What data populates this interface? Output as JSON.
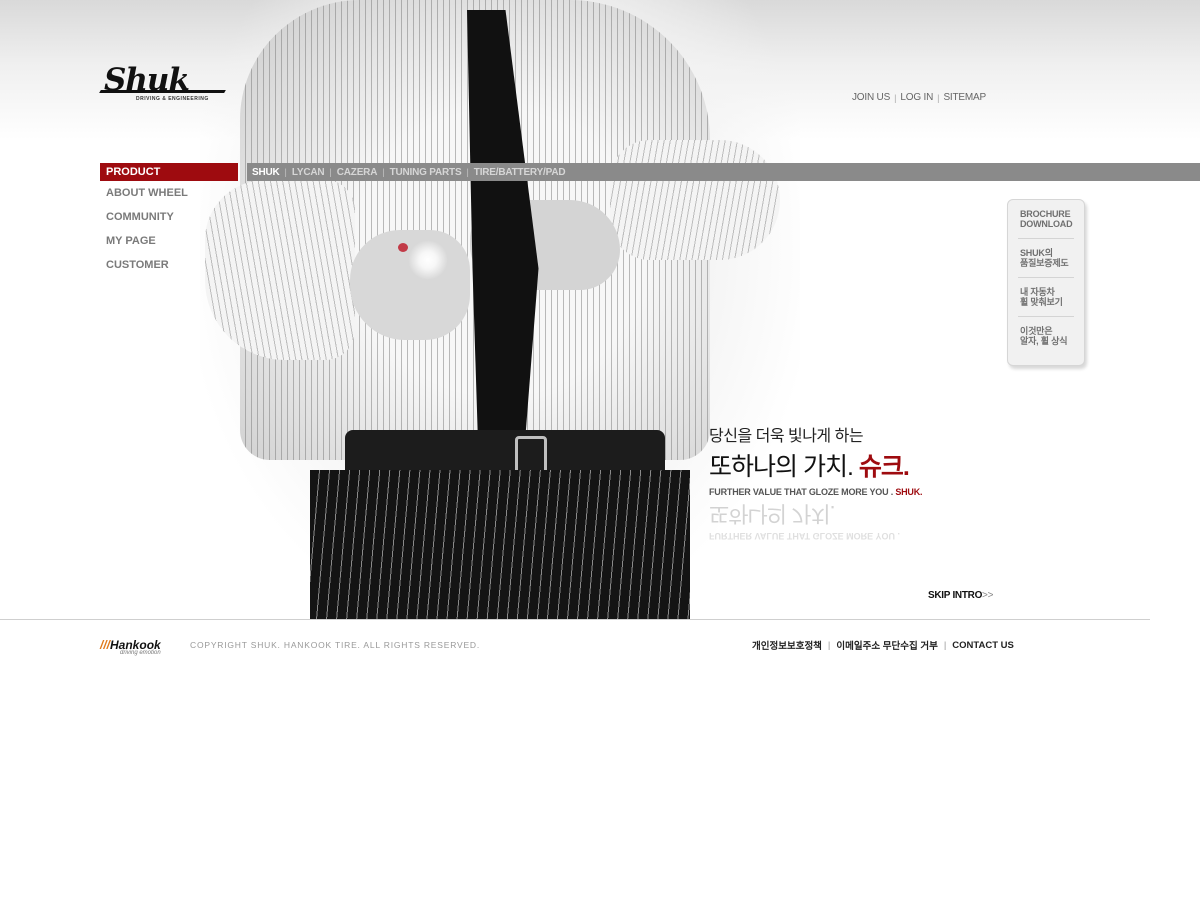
{
  "header": {
    "logo_text": "Shuk",
    "logo_sub": "DRIVING & ENGINEERING",
    "util_nav": [
      "JOIN US",
      "LOG IN",
      "SITEMAP"
    ]
  },
  "left_nav": {
    "active": "PRODUCT",
    "items": [
      "ABOUT WHEEL",
      "COMMUNITY",
      "MY PAGE",
      "CUSTOMER"
    ]
  },
  "product_bar": {
    "items": [
      "SHUK",
      "LYCAN",
      "CAZERA",
      "TUNING PARTS",
      "TIRE/BATTERY/PAD"
    ]
  },
  "side_menu": {
    "items": [
      {
        "line1": "BROCHURE",
        "line2": "DOWNLOAD"
      },
      {
        "line1": "SHUK의",
        "line2": "품질보증제도"
      },
      {
        "line1": "내 자동차",
        "line2": "휠 맞춰보기"
      },
      {
        "line1": "이것만은",
        "line2": "알자, 휠 상식"
      }
    ]
  },
  "tagline": {
    "line1": "당신을 더욱 빛나게 하는",
    "line2": "또하나의 가치.",
    "brand_kr": "슈크.",
    "english": "FURTHER VALUE THAT GLOZE MORE YOU .",
    "brand_en": "SHUK."
  },
  "skip_intro": {
    "label": "SKIP INTRO",
    "arrows": ">>"
  },
  "footer": {
    "logo": "Hankook",
    "logo_sub": "driving emotion",
    "copyright": "COPYRIGHT SHUK. HANKOOK TIRE. ALL RIGHTS RESERVED.",
    "links": [
      "개인정보보호정책",
      "이메일주소 무단수집 거부",
      "CONTACT US"
    ]
  },
  "colors": {
    "accent": "#9e0b0f",
    "bar": "#8a8a8a",
    "hankook_orange": "#e07a1b"
  }
}
